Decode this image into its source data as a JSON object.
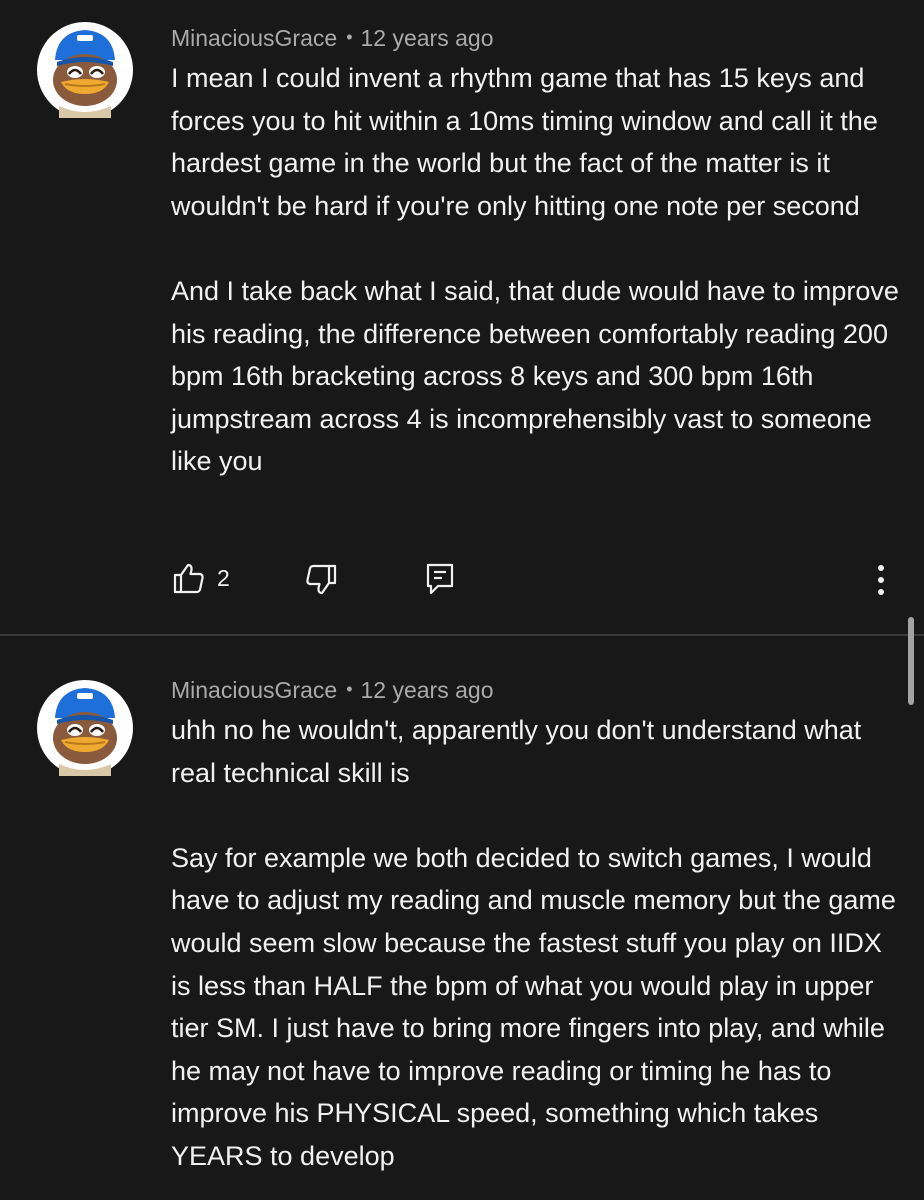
{
  "comments": [
    {
      "author": "MinaciousGrace",
      "separator": "•",
      "time": "12 years ago",
      "paragraphs": [
        "I mean I could invent a rhythm game that has 15 keys and forces you to hit within a 10ms timing window and call it the hardest game in the world but the fact of the matter is it wouldn't be hard if you're only hitting one note per second",
        "And I take back what I said, that dude would have to improve his reading, the difference between comfortably reading 200 bpm 16th bracketing across 8 keys and 300 bpm 16th jumpstream across 4 is incomprehensibly vast to someone like you"
      ],
      "like_count": "2",
      "icons": {
        "like": "thumbs-up-icon",
        "dislike": "thumbs-down-icon",
        "reply": "reply-icon",
        "more": "more-vertical-icon"
      }
    },
    {
      "author": "MinaciousGrace",
      "separator": "•",
      "time": "12 years ago",
      "paragraphs": [
        "uhh no he wouldn't, apparently you don't understand what real technical skill is",
        "Say for example we both decided to switch games, I would have to adjust my reading and muscle memory but the game would seem slow because the fastest stuff you play on IIDX is less than HALF the bpm of what you would play in upper tier SM. I just have to bring more fingers into play, and while he may not have to improve reading or timing he has to improve his PHYSICAL speed, something which takes YEARS to develop"
      ]
    }
  ],
  "colors": {
    "background": "#181818",
    "text": "#f1f1f1",
    "secondary_text": "#aaaaaa",
    "avatar_hat": "#1e6fd9",
    "avatar_face": "#8a5a3c",
    "avatar_beak": "#f0a930"
  }
}
